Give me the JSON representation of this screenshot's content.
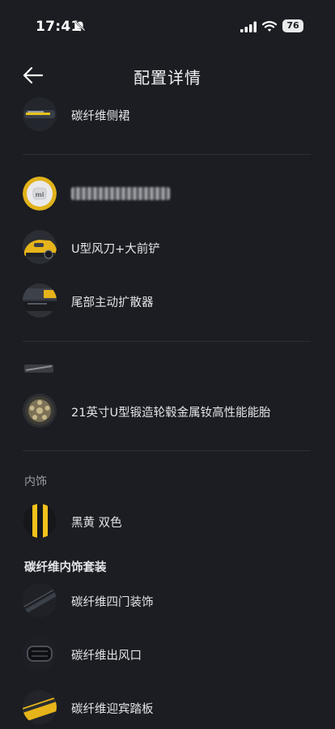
{
  "status": {
    "time": "17:41",
    "battery": "76"
  },
  "header": {
    "title": "配置详情"
  },
  "items": {
    "side_skirt": "碳纤维侧裙",
    "u_spoiler": "U型风刀+大前铲",
    "rear_diffuser": "尾部主动扩散器",
    "wheels": "21英寸U型锻造轮毂金属钕高性能能胎",
    "color": "黑黄 双色",
    "door_trim": "碳纤维四门装饰",
    "air_vent": "碳纤维出风口",
    "sill_plate": "碳纤维迎宾踏板"
  },
  "sections": {
    "interior": "内饰",
    "carbon_package": "碳纤维内饰套装"
  },
  "colors": {
    "background": "#1b1d22",
    "accent_yellow": "#f2c11b"
  }
}
